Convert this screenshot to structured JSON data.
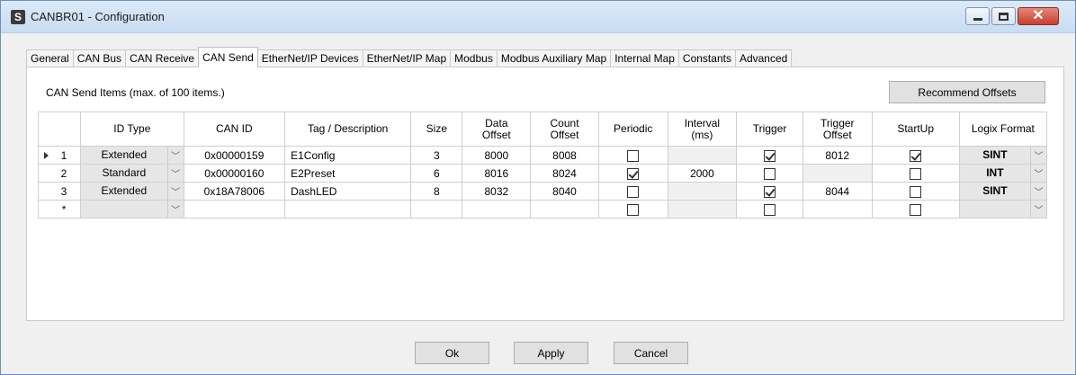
{
  "window": {
    "title": "CANBR01 - Configuration",
    "app_icon_letter": "S"
  },
  "tabs": [
    {
      "label": "General"
    },
    {
      "label": "CAN Bus"
    },
    {
      "label": "CAN Receive"
    },
    {
      "label": "CAN Send",
      "active": true
    },
    {
      "label": "EtherNet/IP Devices"
    },
    {
      "label": "EtherNet/IP Map"
    },
    {
      "label": "Modbus"
    },
    {
      "label": "Modbus Auxiliary Map"
    },
    {
      "label": "Internal Map"
    },
    {
      "label": "Constants"
    },
    {
      "label": "Advanced"
    }
  ],
  "panel": {
    "items_label": "CAN Send Items (max. of 100 items.)",
    "recommend_button": "Recommend Offsets"
  },
  "table": {
    "headers": {
      "id_type": "ID Type",
      "can_id": "CAN ID",
      "tag": "Tag / Description",
      "size": "Size",
      "data_offset_1": "Data",
      "data_offset_2": "Offset",
      "count_offset_1": "Count",
      "count_offset_2": "Offset",
      "periodic": "Periodic",
      "interval_1": "Interval",
      "interval_2": "(ms)",
      "trigger": "Trigger",
      "trigger_offset_1": "Trigger",
      "trigger_offset_2": "Offset",
      "startup": "StartUp",
      "logix_format": "Logix Format"
    },
    "rows": [
      {
        "num": "1",
        "id_type": "Extended",
        "can_id": "0x00000159",
        "tag": "E1Config",
        "size": "3",
        "data_offset": "8000",
        "count_offset": "8008",
        "periodic": false,
        "interval": "",
        "trigger": true,
        "trigger_offset": "8012",
        "startup": true,
        "logix_format": "SINT"
      },
      {
        "num": "2",
        "id_type": "Standard",
        "can_id": "0x00000160",
        "tag": "E2Preset",
        "size": "6",
        "data_offset": "8016",
        "count_offset": "8024",
        "periodic": true,
        "interval": "2000",
        "trigger": false,
        "trigger_offset": "",
        "startup": false,
        "logix_format": "INT"
      },
      {
        "num": "3",
        "id_type": "Extended",
        "can_id": "0x18A78006",
        "tag": "DashLED",
        "size": "8",
        "data_offset": "8032",
        "count_offset": "8040",
        "periodic": false,
        "interval": "",
        "trigger": true,
        "trigger_offset": "8044",
        "startup": false,
        "logix_format": "SINT"
      }
    ],
    "new_row_marker": "*"
  },
  "buttons": {
    "ok": "Ok",
    "apply": "Apply",
    "cancel": "Cancel"
  }
}
